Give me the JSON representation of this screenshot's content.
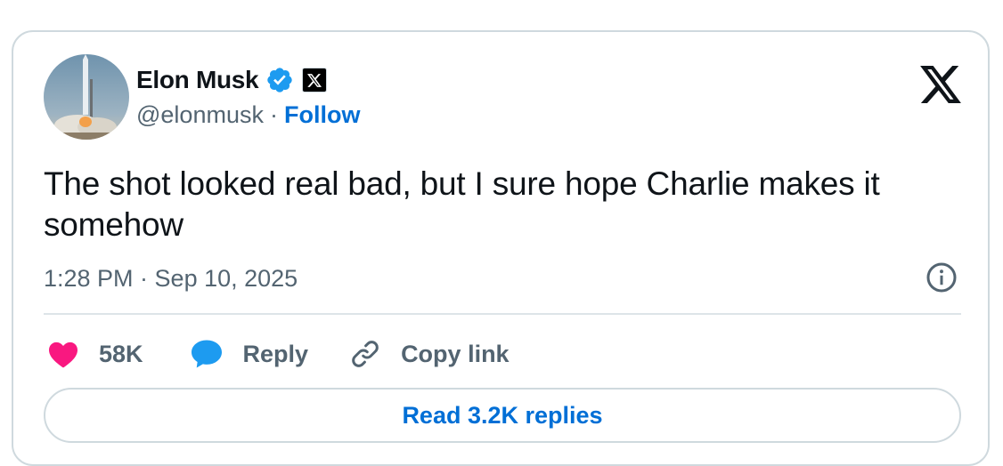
{
  "author": {
    "name": "Elon Musk",
    "handle": "@elonmusk",
    "separator": "·",
    "follow_label": "Follow",
    "verified_color": "#1d9bf0",
    "avatar_icon": "rocket-launch-avatar",
    "affiliation_icon": "x-affiliation-badge"
  },
  "brand": {
    "logo_icon": "x-logo"
  },
  "tweet": {
    "text": "The shot looked real bad, but I sure hope Charlie makes it somehow",
    "timestamp": "1:28 PM · Sep 10, 2025"
  },
  "actions": {
    "like_count": "58K",
    "like_color": "#f91880",
    "reply_label": "Reply",
    "reply_color": "#1d9bf0",
    "copy_label": "Copy link"
  },
  "read_replies_label": "Read 3.2K replies",
  "colors": {
    "link": "#006fd6",
    "text": "#0f1419",
    "secondary": "#536471",
    "border": "#cfd9de"
  }
}
